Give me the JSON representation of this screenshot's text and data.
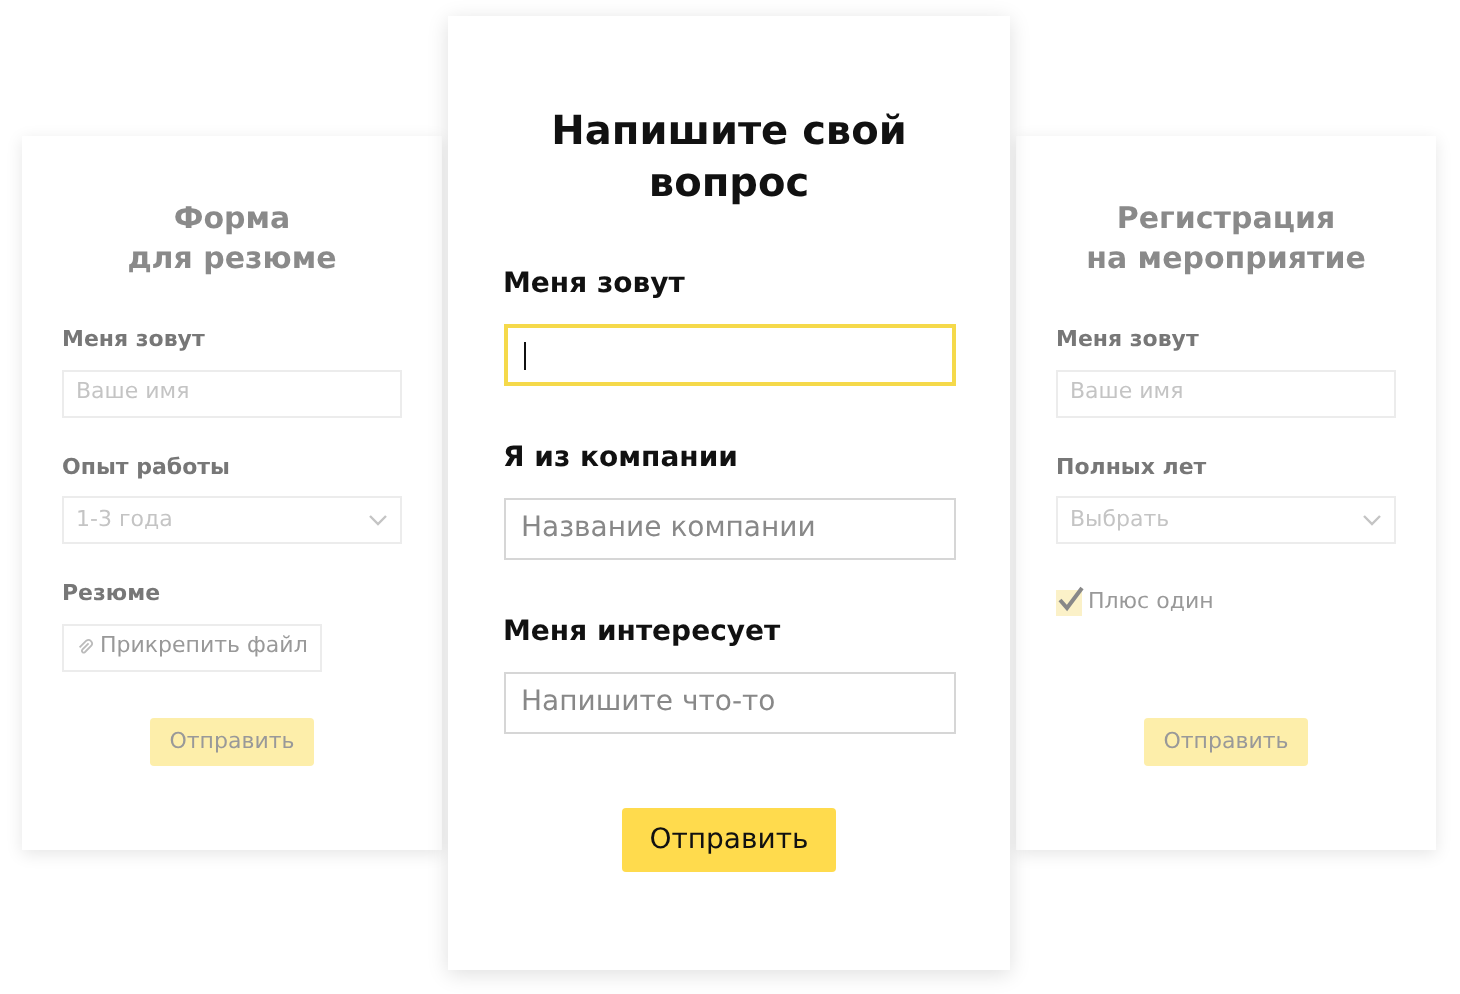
{
  "forms": [
    {
      "title": [
        "Форма",
        "для резюме"
      ],
      "faded": true,
      "fields": [
        {
          "kind": "text",
          "label": "Меня зовут",
          "placeholder": "Ваше имя",
          "focused": false
        },
        {
          "kind": "select",
          "label": "Опыт работы",
          "value": "1-3 года"
        },
        {
          "kind": "file",
          "label": "Резюме",
          "button": "Прикрепить файл"
        }
      ],
      "submit": "Отправить"
    },
    {
      "title": [
        "Напишите свой",
        "вопрос"
      ],
      "faded": false,
      "fields": [
        {
          "kind": "text",
          "label": "Меня зовут",
          "focused": true
        },
        {
          "kind": "text",
          "label": "Я из компании",
          "placeholder": "Название компании",
          "focused": false
        },
        {
          "kind": "text",
          "label": "Меня интересует",
          "placeholder": "Напишите что-то",
          "focused": false
        }
      ],
      "submit": "Отправить"
    },
    {
      "title": [
        "Регистрация",
        "на мероприятие"
      ],
      "faded": true,
      "fields": [
        {
          "kind": "text",
          "label": "Меня зовут",
          "placeholder": "Ваше имя",
          "focused": false
        },
        {
          "kind": "select",
          "label": "Полных лет",
          "placeholder": "Выбрать"
        },
        {
          "kind": "checkbox",
          "label": "Плюс один",
          "checked": true
        }
      ],
      "submit": "Отправить"
    }
  ]
}
